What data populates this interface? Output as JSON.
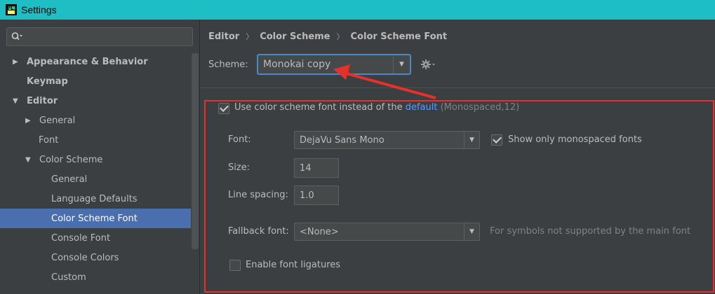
{
  "window": {
    "title": "Settings"
  },
  "colors": {
    "titlebar": "#1ebfc4",
    "selection": "#4b6eaf",
    "accent": "#4a88c7",
    "annotation": "#e6312b",
    "link": "#589df6"
  },
  "sidebar": {
    "search_icon": "search-icon",
    "items": [
      {
        "label": "Appearance & Behavior",
        "arrow": "▶",
        "level": 0,
        "bold": true
      },
      {
        "label": "Keymap",
        "arrow": "",
        "level": 0,
        "bold": true
      },
      {
        "label": "Editor",
        "arrow": "▼",
        "level": 0,
        "bold": true
      },
      {
        "label": "General",
        "arrow": "▶",
        "level": 1,
        "bold": false
      },
      {
        "label": "Font",
        "arrow": "",
        "level": 1,
        "bold": false
      },
      {
        "label": "Color Scheme",
        "arrow": "▼",
        "level": 1,
        "bold": false
      },
      {
        "label": "General",
        "arrow": "",
        "level": 2,
        "bold": false
      },
      {
        "label": "Language Defaults",
        "arrow": "",
        "level": 2,
        "bold": false
      },
      {
        "label": "Color Scheme Font",
        "arrow": "",
        "level": 2,
        "bold": false,
        "selected": true
      },
      {
        "label": "Console Font",
        "arrow": "",
        "level": 2,
        "bold": false
      },
      {
        "label": "Console Colors",
        "arrow": "",
        "level": 2,
        "bold": false
      },
      {
        "label": "Custom",
        "arrow": "",
        "level": 2,
        "bold": false
      }
    ]
  },
  "breadcrumb": {
    "part1": "Editor",
    "part2": "Color Scheme",
    "part3": "Color Scheme Font",
    "sep": "〉"
  },
  "scheme": {
    "label": "Scheme:",
    "value": "Monokai copy",
    "drop": "▼"
  },
  "use_scheme": {
    "checked": true,
    "text": "Use color scheme font instead of the ",
    "link": "default",
    "hint": " (Monospaced,12)"
  },
  "font": {
    "label": "Font:",
    "value": "DejaVu Sans Mono",
    "drop": "▼"
  },
  "mono_only": {
    "checked": true,
    "label": "Show only monospaced fonts"
  },
  "size": {
    "label": "Size:",
    "value": "14"
  },
  "line_spacing": {
    "label": "Line spacing:",
    "value": "1.0"
  },
  "fallback": {
    "label": "Fallback font:",
    "value": "<None>",
    "drop": "▼",
    "hint": "For symbols not supported by the main font"
  },
  "ligatures": {
    "checked": false,
    "label": "Enable font ligatures"
  }
}
